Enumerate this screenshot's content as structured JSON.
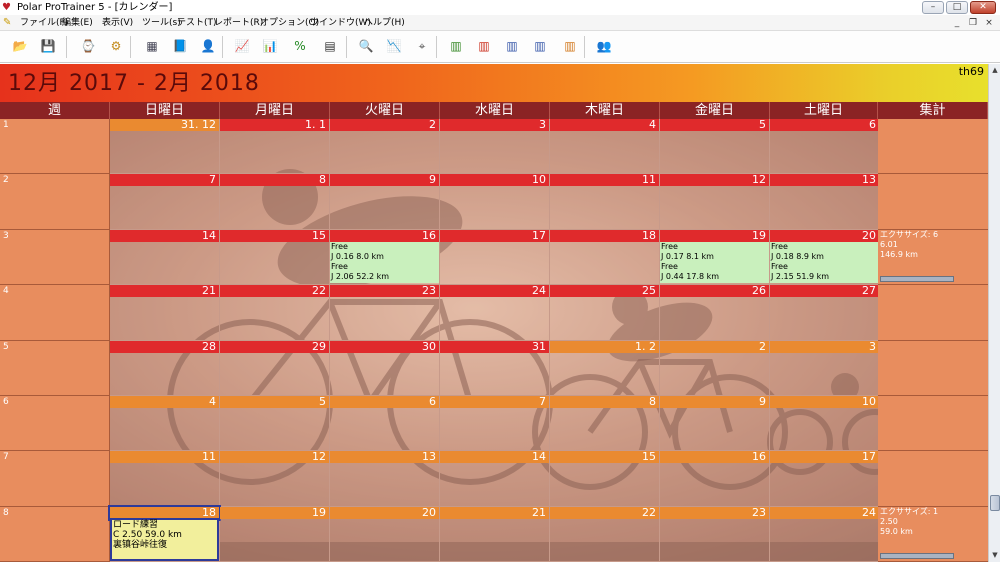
{
  "window": {
    "title": "Polar ProTrainer 5 - [カレンダー]",
    "controls": {
      "min": "–",
      "max": "□",
      "close": "✕"
    },
    "mdi_controls": {
      "min": "_",
      "restore": "❐",
      "close": "×"
    }
  },
  "menu": [
    "ファイル(F)",
    "編集(E)",
    "表示(V)",
    "ツール(s)",
    "テスト(T)",
    "レポート(R)",
    "オプション(O)",
    "ウインドウ(W)",
    "ヘルプ(H)"
  ],
  "toolbar": [
    {
      "icon": "open-folder-icon",
      "glyph": "📂",
      "color": "#c9a120"
    },
    {
      "icon": "save-disk-icon",
      "glyph": "💾",
      "color": "#333"
    },
    {
      "icon": "watch-sync-icon",
      "glyph": "⌚",
      "color": "#444"
    },
    {
      "icon": "watch-settings-icon",
      "glyph": "⚙",
      "color": "#c28a1a"
    },
    {
      "icon": "calendar-grid-icon",
      "glyph": "▦",
      "color": "#445"
    },
    {
      "icon": "diary-book-icon",
      "glyph": "📘",
      "color": "#234c9a"
    },
    {
      "icon": "user-info-icon",
      "glyph": "👤",
      "color": "#a55"
    },
    {
      "icon": "line-chart-icon",
      "glyph": "📈",
      "color": "#b33"
    },
    {
      "icon": "bar-chart-icon",
      "glyph": "📊",
      "color": "#335"
    },
    {
      "icon": "percent-chart-icon",
      "glyph": "%",
      "color": "#282"
    },
    {
      "icon": "table-icon",
      "glyph": "▤",
      "color": "#333"
    },
    {
      "icon": "zoom-1to1-icon",
      "glyph": "🔍",
      "color": "#333"
    },
    {
      "icon": "curve-chart-icon",
      "glyph": "📉",
      "color": "#28a"
    },
    {
      "icon": "compass-icon",
      "glyph": "⌖",
      "color": "#555"
    },
    {
      "icon": "summary-1-icon",
      "glyph": "▥",
      "color": "#3a8a2a"
    },
    {
      "icon": "summary-2-icon",
      "glyph": "▥",
      "color": "#c32"
    },
    {
      "icon": "summary-3-icon",
      "glyph": "▥",
      "color": "#3a5aaa"
    },
    {
      "icon": "summary-4-icon",
      "glyph": "▥",
      "color": "#3a5aaa"
    },
    {
      "icon": "summary-5-icon",
      "glyph": "▥",
      "color": "#d27a20"
    },
    {
      "icon": "users-icon",
      "glyph": "👥",
      "color": "#c33"
    }
  ],
  "banner": {
    "period": "12月  2017 - 2月  2018",
    "user": "th69"
  },
  "headers": [
    "週",
    "日曜日",
    "月曜日",
    "火曜日",
    "水曜日",
    "木曜日",
    "金曜日",
    "土曜日",
    "集計"
  ],
  "weeks": [
    {
      "num": "1",
      "days": [
        {
          "label": "31. 12",
          "m": "oth"
        },
        {
          "label": "1. 1",
          "m": "cur"
        },
        {
          "label": "2",
          "m": "cur"
        },
        {
          "label": "3",
          "m": "cur"
        },
        {
          "label": "4",
          "m": "cur"
        },
        {
          "label": "5",
          "m": "cur"
        },
        {
          "label": "6",
          "m": "cur"
        }
      ],
      "summary": []
    },
    {
      "num": "2",
      "days": [
        {
          "label": "7",
          "m": "cur"
        },
        {
          "label": "8",
          "m": "cur"
        },
        {
          "label": "9",
          "m": "cur"
        },
        {
          "label": "10",
          "m": "cur"
        },
        {
          "label": "11",
          "m": "cur"
        },
        {
          "label": "12",
          "m": "cur"
        },
        {
          "label": "13",
          "m": "cur"
        }
      ],
      "summary": []
    },
    {
      "num": "3",
      "days": [
        {
          "label": "14",
          "m": "cur"
        },
        {
          "label": "15",
          "m": "cur"
        },
        {
          "label": "16",
          "m": "cur",
          "entries": [
            "Free",
            "J 0.16 8.0 km",
            "Free",
            "J 2.06 52.2 km"
          ]
        },
        {
          "label": "17",
          "m": "cur"
        },
        {
          "label": "18",
          "m": "cur"
        },
        {
          "label": "19",
          "m": "cur",
          "entries": [
            "Free",
            "J 0.17 8.1 km",
            "Free",
            "J 0.44 17.8 km"
          ]
        },
        {
          "label": "20",
          "m": "cur",
          "entries": [
            "Free",
            "J 0.18 8.9 km",
            "Free",
            "J 2.15 51.9 km"
          ]
        }
      ],
      "summary": [
        "エクササイズ: 6",
        "6.01",
        "146.9 km"
      ],
      "bar": true
    },
    {
      "num": "4",
      "days": [
        {
          "label": "21",
          "m": "cur"
        },
        {
          "label": "22",
          "m": "cur"
        },
        {
          "label": "23",
          "m": "cur"
        },
        {
          "label": "24",
          "m": "cur"
        },
        {
          "label": "25",
          "m": "cur"
        },
        {
          "label": "26",
          "m": "cur"
        },
        {
          "label": "27",
          "m": "cur"
        }
      ],
      "summary": []
    },
    {
      "num": "5",
      "days": [
        {
          "label": "28",
          "m": "cur"
        },
        {
          "label": "29",
          "m": "cur"
        },
        {
          "label": "30",
          "m": "cur"
        },
        {
          "label": "31",
          "m": "cur"
        },
        {
          "label": "1. 2",
          "m": "oth"
        },
        {
          "label": "2",
          "m": "oth"
        },
        {
          "label": "3",
          "m": "oth"
        }
      ],
      "summary": []
    },
    {
      "num": "6",
      "days": [
        {
          "label": "4",
          "m": "oth"
        },
        {
          "label": "5",
          "m": "oth"
        },
        {
          "label": "6",
          "m": "oth"
        },
        {
          "label": "7",
          "m": "oth"
        },
        {
          "label": "8",
          "m": "oth"
        },
        {
          "label": "9",
          "m": "oth"
        },
        {
          "label": "10",
          "m": "oth"
        }
      ],
      "summary": []
    },
    {
      "num": "7",
      "days": [
        {
          "label": "11",
          "m": "oth"
        },
        {
          "label": "12",
          "m": "oth"
        },
        {
          "label": "13",
          "m": "oth"
        },
        {
          "label": "14",
          "m": "oth"
        },
        {
          "label": "15",
          "m": "oth"
        },
        {
          "label": "16",
          "m": "oth"
        },
        {
          "label": "17",
          "m": "oth"
        }
      ],
      "summary": []
    },
    {
      "num": "8",
      "days": [
        {
          "label": "18",
          "m": "blue",
          "selected": true,
          "entries": [
            "ロード練習",
            "C 2.50 59.0 km",
            "裏镇谷峠往復"
          ]
        },
        {
          "label": "19",
          "m": "oth"
        },
        {
          "label": "20",
          "m": "oth"
        },
        {
          "label": "21",
          "m": "oth"
        },
        {
          "label": "22",
          "m": "oth"
        },
        {
          "label": "23",
          "m": "oth"
        },
        {
          "label": "24",
          "m": "oth"
        }
      ],
      "summary": [
        "エクササイズ: 1",
        "2.50",
        "59.0 km"
      ],
      "bar": true
    }
  ]
}
